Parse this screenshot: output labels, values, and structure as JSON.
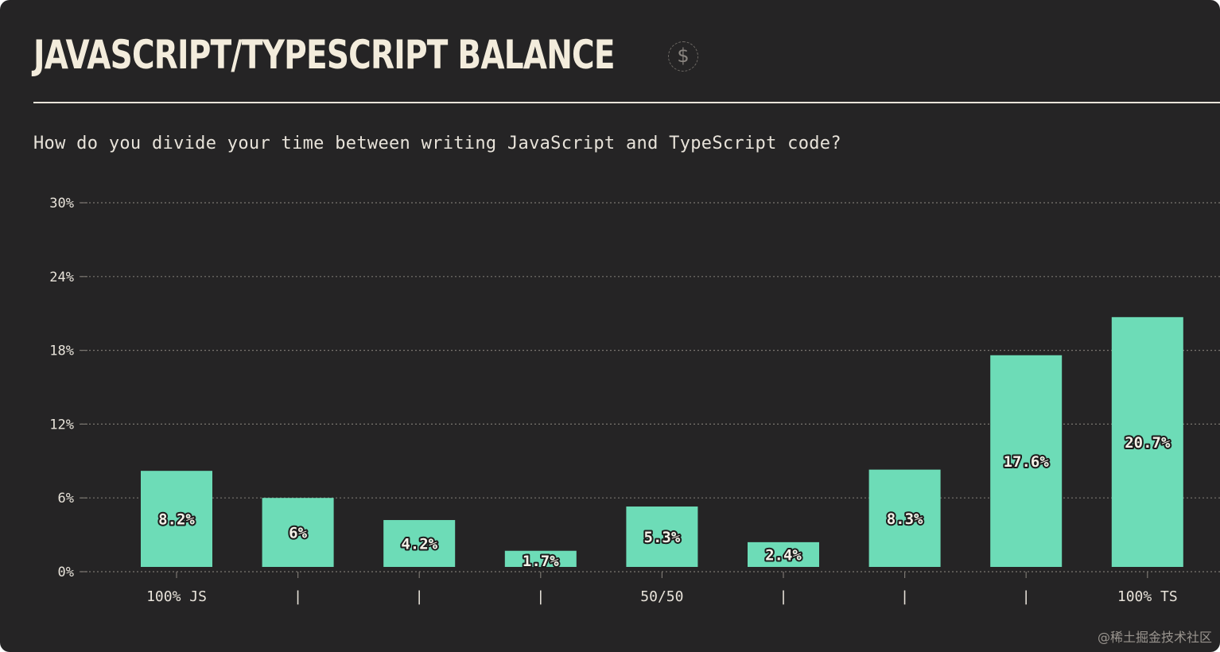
{
  "header": {
    "title": "JAVASCRIPT/TYPESCRIPT BALANCE",
    "icon": "dollar-sponsor-icon",
    "question": "How do you divide your time between writing JavaScript and TypeScript code?"
  },
  "colors": {
    "background": "#252425",
    "bar": "#6ddcb7",
    "text": "#e8e3da",
    "grid": "#7a7670"
  },
  "chart_data": {
    "type": "bar",
    "categories": [
      "100% JS",
      "|",
      "|",
      "|",
      "50/50",
      "|",
      "|",
      "|",
      "100% TS"
    ],
    "values": [
      8.2,
      6,
      4.2,
      1.7,
      5.3,
      2.4,
      8.3,
      17.6,
      20.7
    ],
    "value_labels": [
      "8.2%",
      "6%",
      "4.2%",
      "1.7%",
      "5.3%",
      "2.4%",
      "8.3%",
      "17.6%",
      "20.7%"
    ],
    "y_ticks": [
      0,
      6,
      12,
      18,
      24,
      30
    ],
    "y_tick_labels": [
      "0%",
      "6%",
      "12%",
      "18%",
      "24%",
      "30%"
    ],
    "ylim": [
      0,
      30
    ],
    "grid": true,
    "xlabel": "",
    "ylabel": ""
  },
  "watermark": "@稀土掘金技术社区"
}
